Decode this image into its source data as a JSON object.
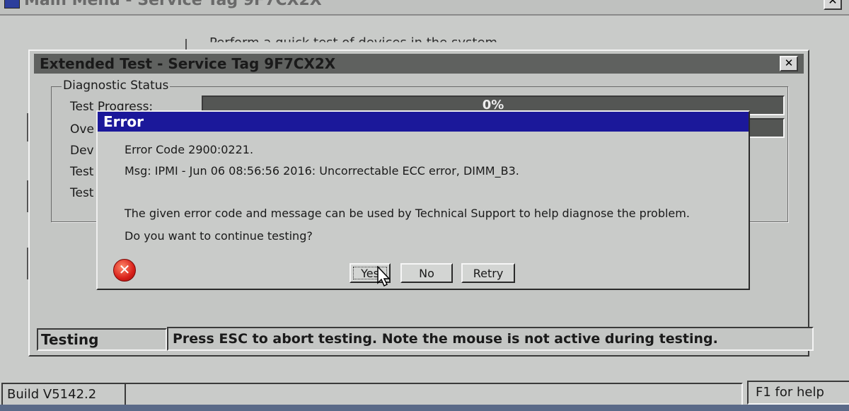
{
  "main_window": {
    "title": "Main Menu - Service Tag 9F7CX2X",
    "close_symbol": "✕",
    "background_text": "Perform a quick test of devices in the system"
  },
  "extended_test": {
    "title": "Extended Test - Service Tag 9F7CX2X",
    "close_symbol": "✕",
    "diagnostic_group_label": "Diagnostic Status",
    "labels": [
      "Test Progress:",
      "Ove",
      "Dev",
      "Test",
      "Test"
    ],
    "test_progress": "0%",
    "status_mode": "Testing",
    "status_message": "Press ESC to abort testing.  Note the mouse is not active during testing."
  },
  "error_dialog": {
    "title": "Error",
    "error_code": "Error Code  2900:0221.",
    "message": "Msg: IPMI - Jun 06 08:56:56 2016: Uncorrectable ECC error, DIMM_B3.",
    "info": "The given error code and message can be used by Technical Support to help diagnose the problem.",
    "question": "Do you want to continue testing?",
    "icon": "error-x-icon",
    "buttons": {
      "yes": "Yes",
      "no": "No",
      "retry": "Retry"
    }
  },
  "bottom_bar": {
    "build": "Build  V5142.2",
    "help": "F1 for help"
  },
  "colors": {
    "error_titlebar": "#1b189a",
    "window_titlebar": "#5f615f",
    "face": "#c9cbc9"
  }
}
